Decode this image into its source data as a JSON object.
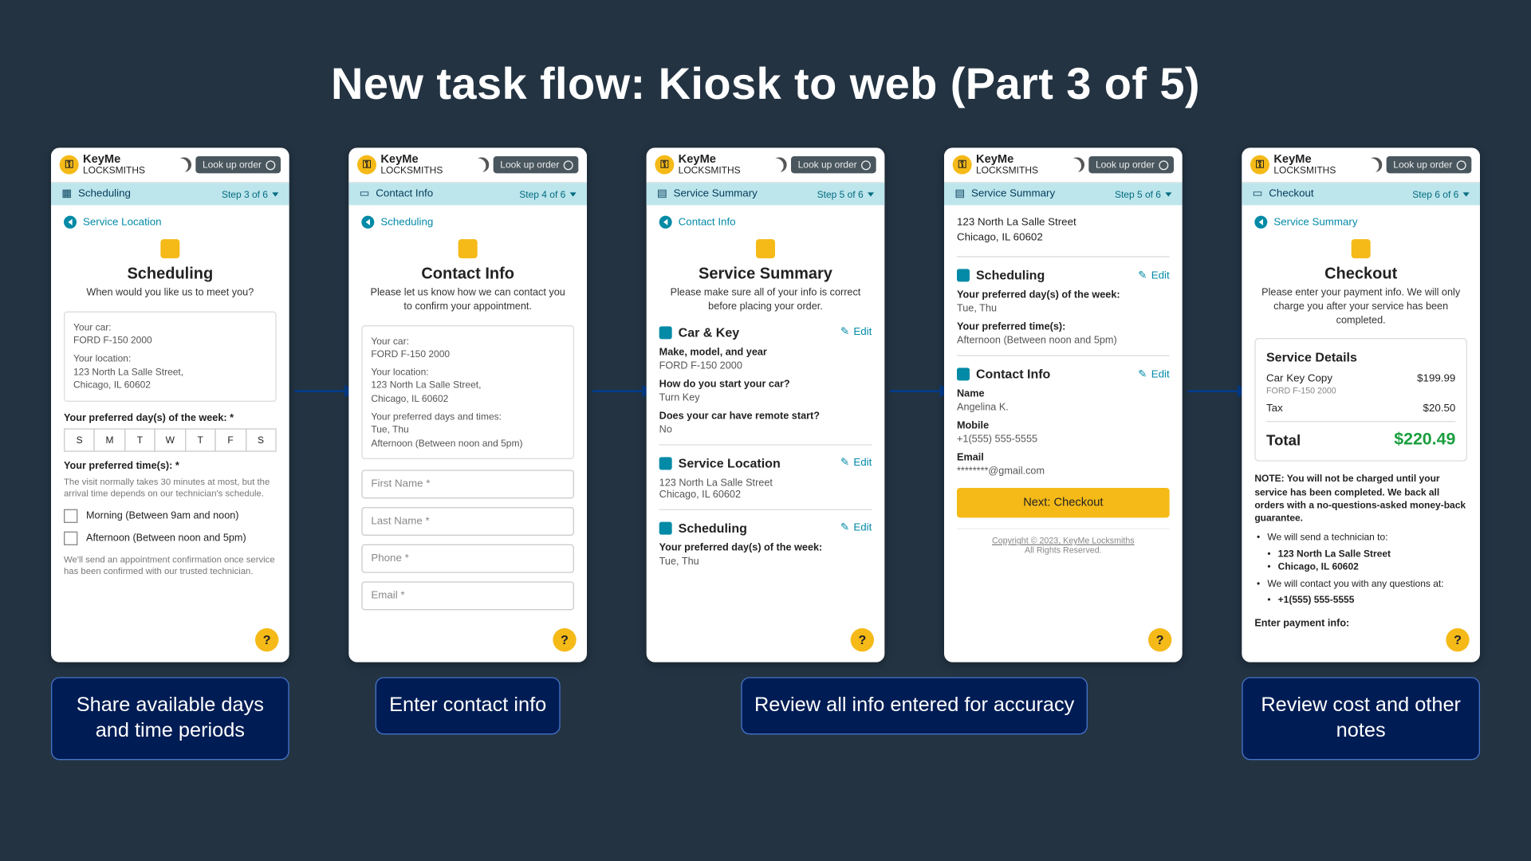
{
  "title": "New task flow: Kiosk to web (Part 3 of 5)",
  "brand": {
    "name": "KeyMe",
    "sub": "LOCKSMITHS"
  },
  "lookup": "Look up order",
  "captions": {
    "c1": "Share available days and time periods",
    "c2": "Enter contact info",
    "c3": "Review all info entered for accuracy",
    "c4": "Review cost and other notes"
  },
  "screen1": {
    "crumb": "Scheduling",
    "step": "Step 3 of 6",
    "back": "Service Location",
    "h": "Scheduling",
    "sub": "When would you like us to meet you?",
    "carLabel": "Your car:",
    "car": "FORD F-150 2000",
    "locLabel": "Your location:",
    "loc1": "123 North La Salle Street,",
    "loc2": "Chicago, IL 60602",
    "daysLabel": "Your preferred day(s) of the week: *",
    "days": [
      "S",
      "M",
      "T",
      "W",
      "T",
      "F",
      "S"
    ],
    "timeLabel": "Your preferred time(s): *",
    "timeNote": "The visit normally takes 30 minutes at most, but the arrival time depends on our technician's schedule.",
    "opt1": "Morning (Between 9am and noon)",
    "opt2": "Afternoon (Between noon and 5pm)",
    "foot": "We'll send an appointment confirmation once service has been confirmed with our trusted technician."
  },
  "screen2": {
    "crumb": "Contact Info",
    "step": "Step 4 of 6",
    "back": "Scheduling",
    "h": "Contact Info",
    "sub": "Please let us know how we can contact you to confirm your appointment.",
    "carLabel": "Your car:",
    "car": "FORD F-150 2000",
    "locLabel": "Your location:",
    "loc1": "123 North La Salle Street,",
    "loc2": "Chicago, IL 60602",
    "prefLabel": "Your preferred days and times:",
    "pref1": "Tue, Thu",
    "pref2": "Afternoon (Between noon and 5pm)",
    "ph1": "First Name *",
    "ph2": "Last Name *",
    "ph3": "Phone *",
    "ph4": "Email *"
  },
  "screen3": {
    "crumb": "Service Summary",
    "step": "Step 5 of 6",
    "back": "Contact Info",
    "h": "Service Summary",
    "sub": "Please make sure all of your info is correct before placing your order.",
    "edit": "Edit",
    "s1": "Car & Key",
    "q1": "Make, model, and year",
    "a1": "FORD F-150 2000",
    "q2": "How do you start your car?",
    "a2": "Turn Key",
    "q3": "Does your car have remote start?",
    "a3": "No",
    "s2": "Service Location",
    "addr1": "123 North La Salle Street",
    "addr2": "Chicago, IL 60602",
    "s3": "Scheduling",
    "dl": "Your preferred day(s) of the week:",
    "dv": "Tue, Thu"
  },
  "screen4": {
    "crumb": "Service Summary",
    "step": "Step 5 of 6",
    "addr1": "123 North La Salle Street",
    "addr2": "Chicago, IL 60602",
    "edit": "Edit",
    "s1": "Scheduling",
    "dl": "Your preferred day(s) of the week:",
    "dv": "Tue, Thu",
    "tl": "Your preferred time(s):",
    "tv": "Afternoon (Between noon and 5pm)",
    "s2": "Contact Info",
    "nameL": "Name",
    "name": "Angelina K.",
    "mobL": "Mobile",
    "mob": "+1(555) 555-5555",
    "emL": "Email",
    "em": "********@gmail.com",
    "next": "Next: Checkout",
    "copy": "Copyright © 2023, KeyMe Locksmiths",
    "rights": "All Rights Reserved."
  },
  "screen5": {
    "crumb": "Checkout",
    "step": "Step 6 of 6",
    "back": "Service Summary",
    "h": "Checkout",
    "sub": "Please enter your payment info. We will only charge you after your service has been completed.",
    "svc": "Service Details",
    "l1a": "Car Key Copy",
    "l1b": "$199.99",
    "l1s": "FORD F-150 2000",
    "l2a": "Tax",
    "l2b": "$20.50",
    "totL": "Total",
    "totV": "$220.49",
    "note": "NOTE: You will not be charged until your service has been completed. We back all orders with a no-questions-asked money-back guarantee.",
    "b1": "We will send a technician to:",
    "b1a": "123 North La Salle Street",
    "b1b": "Chicago, IL 60602",
    "b2": "We will contact you with any questions at:",
    "b2a": "+1(555) 555-5555",
    "pay": "Enter payment info:"
  }
}
